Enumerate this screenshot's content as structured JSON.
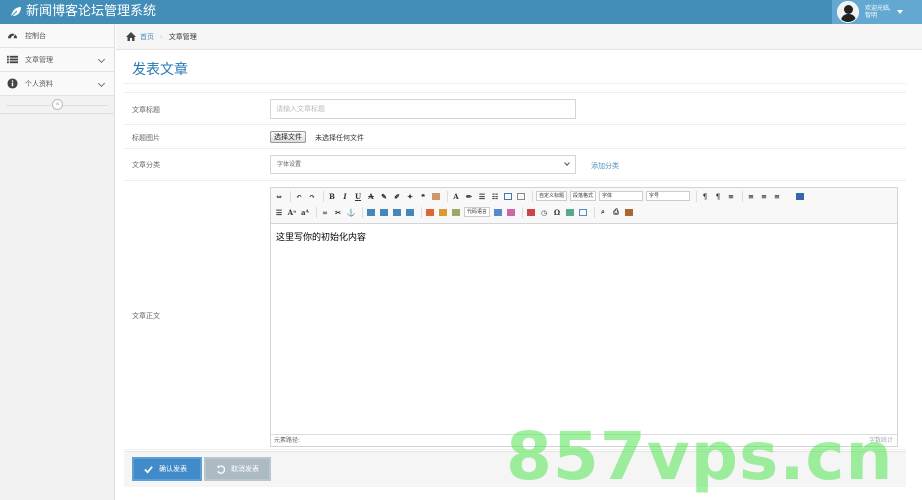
{
  "header": {
    "app_title": "新闻博客论坛管理系统",
    "user_greeting": "欢迎光临,",
    "user_name": "智明"
  },
  "sidebar": {
    "items": [
      {
        "label": "控制台",
        "icon": "dashboard-icon"
      },
      {
        "label": "文章管理",
        "icon": "list-icon"
      },
      {
        "label": "个人资料",
        "icon": "info-icon"
      }
    ],
    "collapse_glyph": "«"
  },
  "breadcrumb": {
    "home": "首页",
    "current": "文章管理"
  },
  "page": {
    "title": "发表文章"
  },
  "form": {
    "title_label": "文章标题",
    "title_placeholder": "请输入文章标题",
    "image_label": "标题图片",
    "file_button": "选择文件",
    "file_status": "未选择任何文件",
    "category_label": "文章分类",
    "category_value": "字体设置",
    "add_category": "添加分类",
    "content_label": "文章正文"
  },
  "editor": {
    "initial_content": "这里写你的初始化内容",
    "status_left": "元素路径:",
    "status_right": "字数统计",
    "combos": {
      "para_format": "自定义标题",
      "paragraph": "段落格式",
      "font_family": "字体",
      "font_size": "字号",
      "code_lang": "代码语言"
    }
  },
  "actions": {
    "submit": "确认发表",
    "reset": "取消发表"
  },
  "colors": {
    "header_bg": "#438eb9",
    "primary": "#428bca",
    "link": "#4c8fbd"
  },
  "watermark": "857vps.cn"
}
